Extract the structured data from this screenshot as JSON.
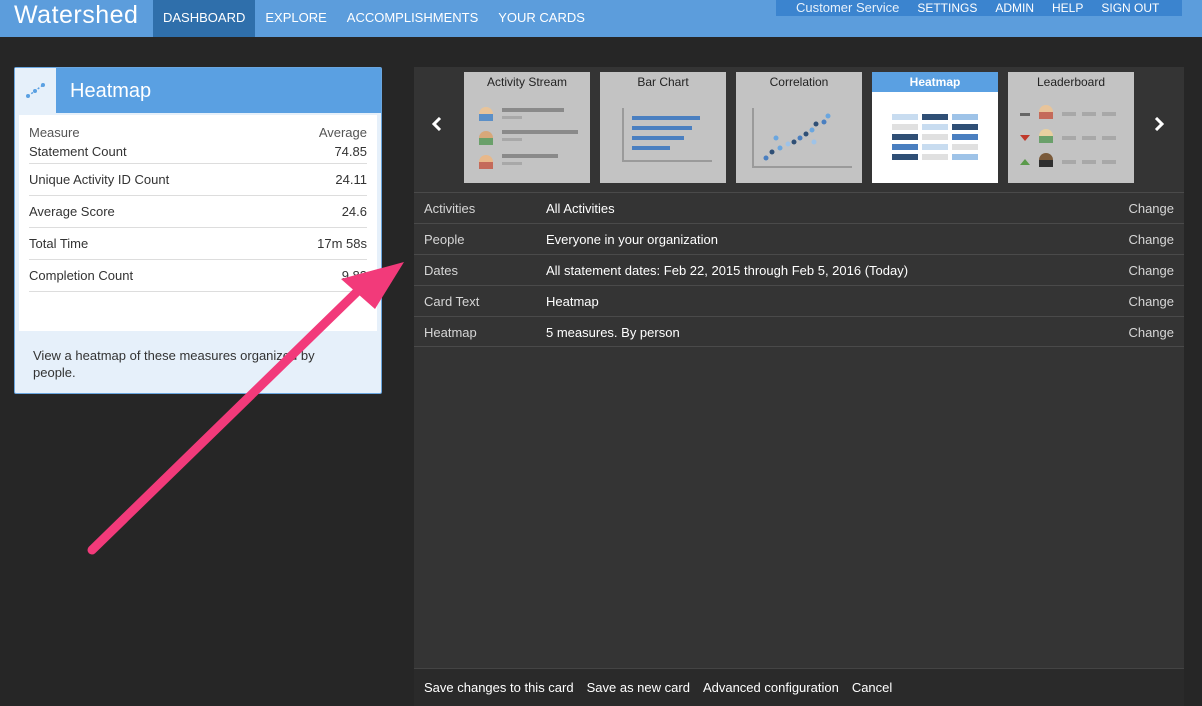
{
  "nav": {
    "logo": "Watershed",
    "items": [
      "DASHBOARD",
      "EXPLORE",
      "ACCOMPLISHMENTS",
      "YOUR CARDS"
    ],
    "secondary": [
      "Customer Service",
      "SETTINGS",
      "ADMIN",
      "HELP",
      "SIGN OUT"
    ]
  },
  "card": {
    "icon": "correlation-icon",
    "title": "Heatmap",
    "header": {
      "measure": "Measure",
      "average": "Average"
    },
    "rows": [
      {
        "label": "Statement Count",
        "value": "74.85"
      },
      {
        "label": "Unique Activity ID Count",
        "value": "24.11"
      },
      {
        "label": "Average Score",
        "value": "24.6"
      },
      {
        "label": "Total Time",
        "value": "17m 58s"
      },
      {
        "label": "Completion Count",
        "value": "9.83"
      }
    ],
    "description": "View a heatmap of these measures organized by people."
  },
  "carousel": {
    "prev_icon": "chevron-left-icon",
    "next_icon": "chevron-right-icon",
    "types": [
      "Activity Stream",
      "Bar Chart",
      "Correlation",
      "Heatmap",
      "Leaderboard"
    ],
    "selected": "Heatmap"
  },
  "settings": [
    {
      "key": "Activities",
      "value": "All Activities",
      "action": "Change"
    },
    {
      "key": "People",
      "value": "Everyone in your organization",
      "action": "Change"
    },
    {
      "key": "Dates",
      "value": "All statement dates: Feb 22, 2015 through Feb 5, 2016 (Today)",
      "action": "Change"
    },
    {
      "key": "Card Text",
      "value": "Heatmap",
      "action": "Change"
    },
    {
      "key": "Heatmap",
      "value": "5 measures. By person",
      "action": "Change"
    }
  ],
  "footer": {
    "save": "Save changes to this card",
    "save_new": "Save as new card",
    "advanced": "Advanced configuration",
    "cancel": "Cancel"
  },
  "colors": {
    "nav_bg": "#5c9ddc",
    "nav_active": "#2f6fab",
    "accent_blue": "#5aa0e2",
    "annotation_arrow": "#f23a7a"
  }
}
